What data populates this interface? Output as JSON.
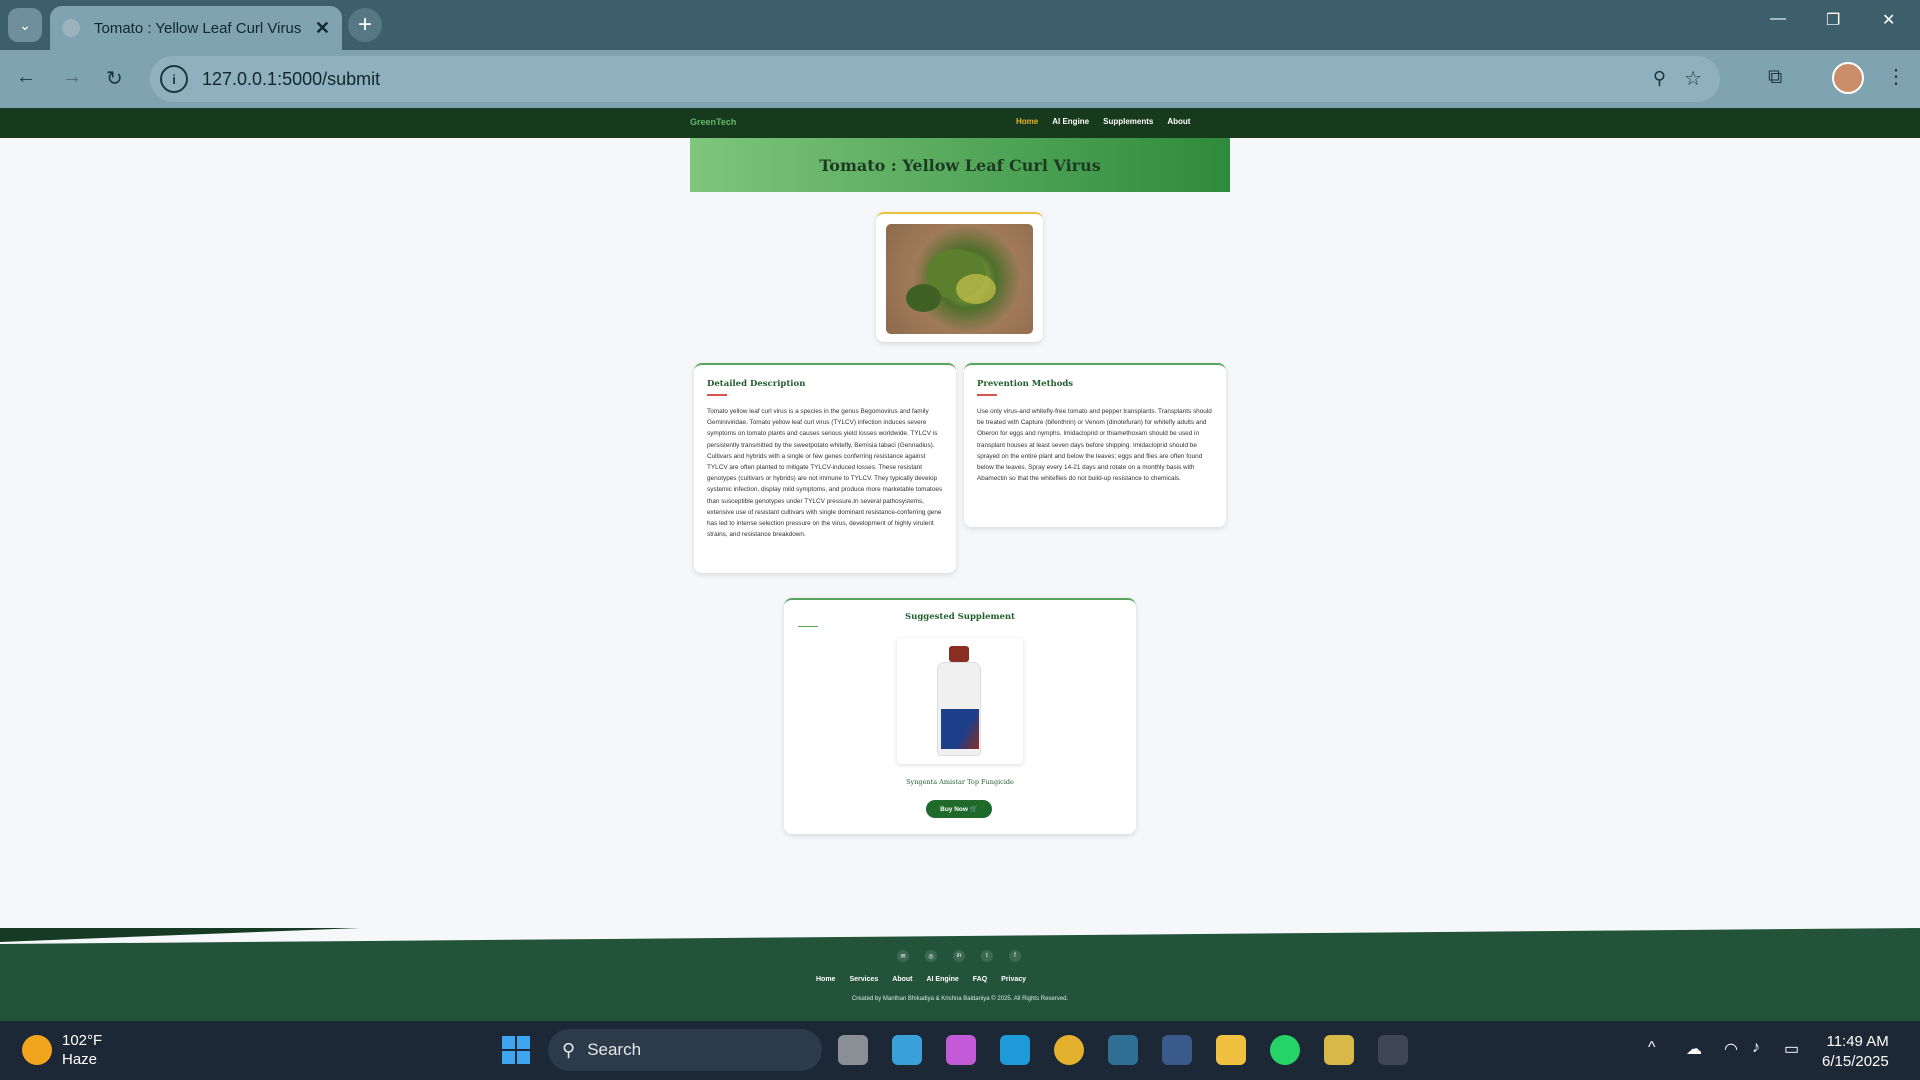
{
  "browser": {
    "tab_title": "Tomato : Yellow Leaf Curl Virus",
    "tab_close": "✕",
    "new_tab": "+",
    "url": "127.0.0.1:5000/submit",
    "window_controls": {
      "minimize": "—",
      "restore": "❐",
      "close": "✕"
    }
  },
  "site": {
    "brand": "GreenTech",
    "nav": [
      {
        "label": "Home"
      },
      {
        "label": "AI Engine"
      },
      {
        "label": "Supplements"
      },
      {
        "label": "About"
      }
    ],
    "title": "Tomato : Yellow Leaf Curl Virus",
    "description": {
      "heading": "Detailed Description",
      "text": "Tomato yellow leaf curl virus is a species in the genus Begomovirus and family Geminiviridae. Tomato yellow leaf curl virus (TYLCV) infection induces severe symptoms on tomato plants and causes serious yield losses worldwide. TYLCV is persistently transmitted by the sweetpotato whitefly, Bemisia tabaci (Gennadius). Cultivars and hybrids with a single or few genes conferring resistance against TYLCV are often planted to mitigate TYLCV-induced losses. These resistant genotypes (cultivars or hybrids) are not immune to TYLCV. They typically develop systemic infection, display mild symptoms, and produce more marketable tomatoes than susceptible genotypes under TYLCV pressure.In several pathosystems, extensive use of resistant cultivars with single dominant resistance-conferring gene has led to intense selection pressure on the virus, development of highly virulent strains, and resistance breakdown."
    },
    "prevention": {
      "heading": "Prevention Methods",
      "text": "Use only virus-and whitefly-free tomato and pepper transplants. Transplants should be treated with Capture (bifenthrin) or Venom (dinotefuran) for whitefly adults and Oberon for eggs and nymphs. Imidacloprid or thiamethoxam should be used in transplant houses at least seven days before shipping. Imidacloprid should be sprayed on the entire plant and below the leaves; eggs and flies are often found below the leaves. Spray every 14-21 days and rotate on a monthly basis with Abamectin so that the whiteflies do not build-up resistance to chemicals."
    },
    "supplement": {
      "heading": "Suggested Supplement",
      "product_name": "Syngenta Amistar Top Fungicide",
      "buy_label": "Buy Now 🛒"
    },
    "footer": {
      "social": [
        "✉",
        "◎",
        "in",
        "t",
        "f"
      ],
      "links": [
        "Home",
        "Services",
        "About",
        "AI Engine",
        "FAQ",
        "Privacy"
      ],
      "copyright": "Created by Manthan Bhikadiya & Krishna Baldaniya © 2025. All Rights Reserved."
    }
  },
  "taskbar": {
    "temperature": "102°F",
    "condition": "Haze",
    "search_label": "Search",
    "time": "11:49 AM",
    "date": "6/15/2025"
  },
  "colors": {
    "nav": "#173a1e",
    "accent": "#e8b21e",
    "footer": "#23543a"
  }
}
